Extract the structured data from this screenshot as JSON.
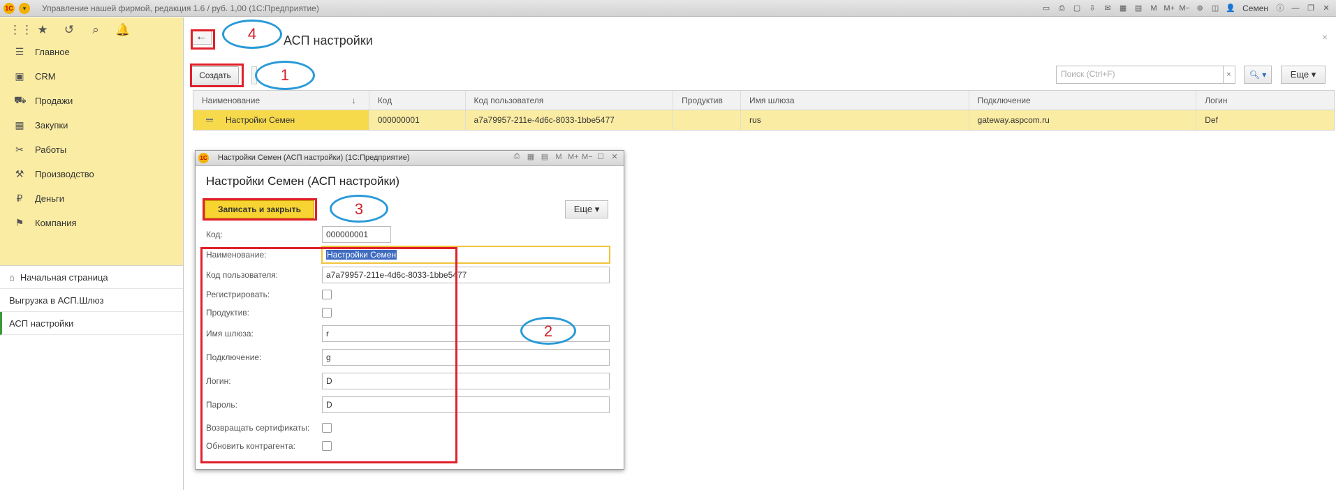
{
  "app": {
    "title": "Управление нашей фирмой, редакция 1.6 / руб. 1,00  (1С:Предприятие)",
    "user": "Семен",
    "logo": "1С"
  },
  "sidebar": {
    "items": [
      {
        "label": "Главное",
        "icon": "menu-lines-icon"
      },
      {
        "label": "CRM",
        "icon": "contacts-icon"
      },
      {
        "label": "Продажи",
        "icon": "basket-icon"
      },
      {
        "label": "Закупки",
        "icon": "boxes-icon"
      },
      {
        "label": "Работы",
        "icon": "tools-icon"
      },
      {
        "label": "Производство",
        "icon": "wrench-icon"
      },
      {
        "label": "Деньги",
        "icon": "ruble-icon"
      },
      {
        "label": "Компания",
        "icon": "flag-icon"
      }
    ],
    "sections": [
      {
        "label": "Начальная страница"
      },
      {
        "label": "Выгрузка в АСП.Шлюз"
      },
      {
        "label": "АСП настройки"
      }
    ]
  },
  "main": {
    "title": "АСП настройки",
    "create_label": "Создать",
    "search_placeholder": "Поиск (Ctrl+F)",
    "more_label": "Еще",
    "table": {
      "headers": [
        "Наименование",
        "Код",
        "Код пользователя",
        "Продуктив",
        "Имя шлюза",
        "Подключение",
        "Логин"
      ],
      "rows": [
        [
          "Настройки Семен",
          "000000001",
          "a7a79957-211e-4d6c-8033-1bbe5477",
          "",
          "rus",
          "gateway.aspcom.ru",
          "Def"
        ]
      ]
    }
  },
  "dialog": {
    "window_title": "Настройки Семен (АСП настройки)  (1С:Предприятие)",
    "heading": "Настройки Семен (АСП настройки)",
    "save_label": "Записать и закрыть",
    "more_label": "Еще",
    "fields": {
      "code": {
        "label": "Код:",
        "value": "000000001"
      },
      "name": {
        "label": "Наименование:",
        "value": "Настройки Семен"
      },
      "user_code": {
        "label": "Код пользователя:",
        "value": "a7a79957-211e-4d6c-8033-1bbe5477"
      },
      "register": {
        "label": "Регистрировать:"
      },
      "productive": {
        "label": "Продуктив:"
      },
      "gateway": {
        "label": "Имя шлюза:",
        "value": "r"
      },
      "connection": {
        "label": "Подключение:",
        "value": "g"
      },
      "login": {
        "label": "Логин:",
        "value": "D"
      },
      "password": {
        "label": "Пароль:",
        "value": "D"
      },
      "return_certs": {
        "label": "Возвращать сертификаты:"
      },
      "update_contractor": {
        "label": "Обновить контрагента:"
      }
    }
  },
  "annotations": [
    "1",
    "2",
    "3",
    "4"
  ],
  "colors": {
    "sidebar_bg": "#fbeca3",
    "highlight": "#f7d432",
    "annotation_red": "#e0202a",
    "annotation_blue": "#2a9ad8"
  }
}
